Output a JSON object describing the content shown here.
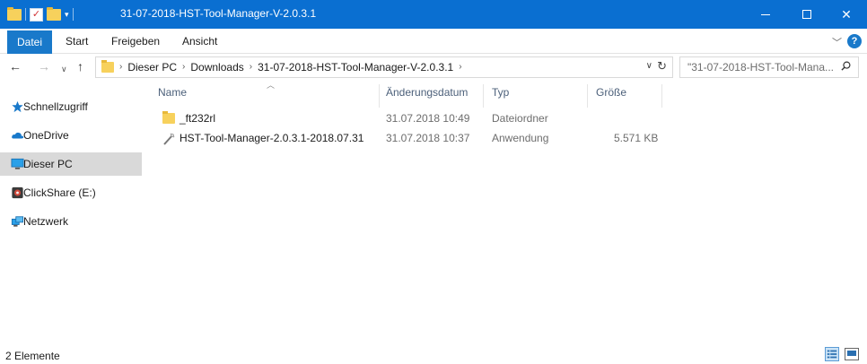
{
  "window": {
    "title": "31-07-2018-HST-Tool-Manager-V-2.0.3.1",
    "titlebar_color": "#0a6fd1"
  },
  "ribbon": {
    "tabs": [
      {
        "label": "Datei",
        "active": true
      },
      {
        "label": "Start"
      },
      {
        "label": "Freigeben"
      },
      {
        "label": "Ansicht"
      }
    ]
  },
  "address": {
    "breadcrumbs": [
      "Dieser PC",
      "Downloads",
      "31-07-2018-HST-Tool-Manager-V-2.0.3.1"
    ],
    "search_placeholder": "\"31-07-2018-HST-Tool-Mana..."
  },
  "sidebar": {
    "items": [
      {
        "label": "Schnellzugriff",
        "icon": "star-icon"
      },
      {
        "label": "OneDrive",
        "icon": "cloud-icon"
      },
      {
        "label": "Dieser PC",
        "icon": "monitor-icon",
        "selected": true
      },
      {
        "label": "ClickShare (E:)",
        "icon": "drive-icon"
      },
      {
        "label": "Netzwerk",
        "icon": "network-icon"
      }
    ]
  },
  "columns": {
    "name": "Name",
    "date": "Änderungsdatum",
    "type": "Typ",
    "size": "Größe"
  },
  "files": [
    {
      "name": "_ft232rl",
      "date": "31.07.2018 10:49",
      "type": "Dateiordner",
      "size": "",
      "icon": "folder-icon"
    },
    {
      "name": "HST-Tool-Manager-2.0.3.1-2018.07.31",
      "date": "31.07.2018 10:37",
      "type": "Anwendung",
      "size": "5.571 KB",
      "icon": "application-icon"
    }
  ],
  "status": {
    "item_count": "2 Elemente"
  }
}
